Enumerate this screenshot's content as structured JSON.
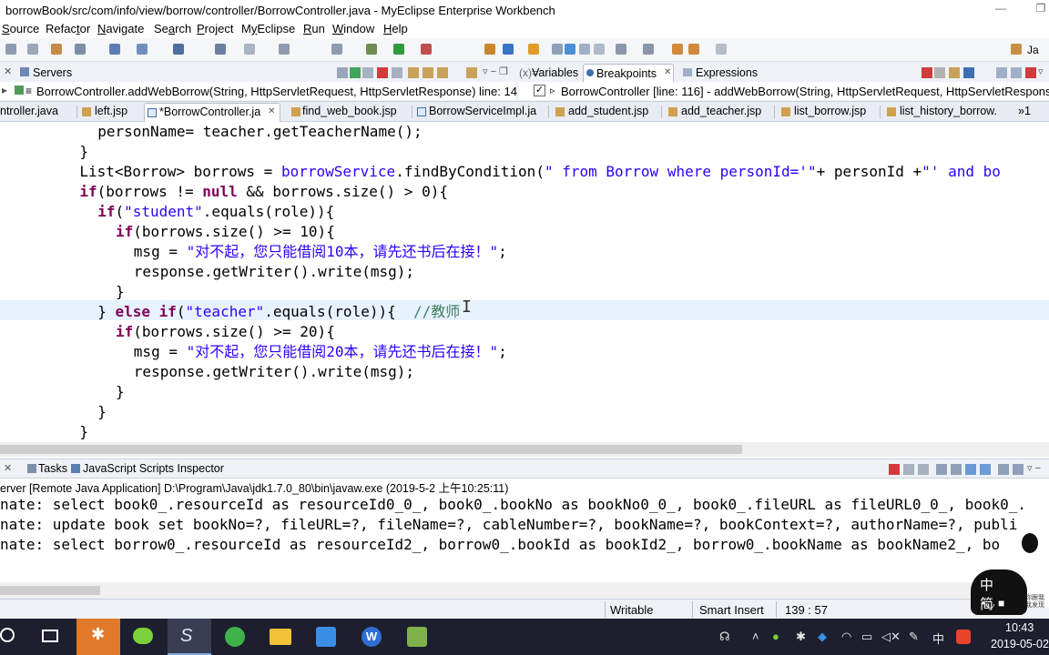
{
  "window": {
    "title": "borrowBook/src/com/info/view/borrow/controller/BorrowController.java - MyEclipse Enterprise Workbench",
    "minimize": "—",
    "restore": "❐"
  },
  "menu": [
    {
      "label": "Source",
      "mnemonic": "S"
    },
    {
      "label": "Refactor",
      "mnemonic": "t"
    },
    {
      "label": "Navigate",
      "mnemonic": "N"
    },
    {
      "label": "Search",
      "mnemonic": "a"
    },
    {
      "label": "Project",
      "mnemonic": "P"
    },
    {
      "label": "MyEclipse",
      "mnemonic": "y"
    },
    {
      "label": "Run",
      "mnemonic": "R"
    },
    {
      "label": "Window",
      "mnemonic": "W"
    },
    {
      "label": "Help",
      "mnemonic": "H"
    }
  ],
  "perspective": {
    "label": "Ja"
  },
  "top_views": {
    "servers_tab": "Servers",
    "debug_tabs": [
      "Variables",
      "Breakpoints",
      "Expressions"
    ],
    "stack_frame": "BorrowController.addWebBorrow(String, HttpServletRequest, HttpServletResponse) line: 14",
    "breakpoint_item": "BorrowController [line: 116] - addWebBorrow(String, HttpServletRequest, HttpServletRespons"
  },
  "editor_tabs": [
    {
      "label": "ntroller.java"
    },
    {
      "label": "left.jsp"
    },
    {
      "label": "*BorrowController.ja"
    },
    {
      "label": "find_web_book.jsp"
    },
    {
      "label": "BorrowServiceImpl.ja"
    },
    {
      "label": "add_student.jsp"
    },
    {
      "label": "add_teacher.jsp"
    },
    {
      "label": "list_borrow.jsp"
    },
    {
      "label": "list_history_borrow."
    },
    {
      "label": "»1"
    }
  ],
  "code_lines": [
    {
      "indent": "        ",
      "parts": [
        {
          "t": "personName= teacher.getTeacherName();",
          "c": ""
        }
      ]
    },
    {
      "indent": "      ",
      "parts": [
        {
          "t": "}",
          "c": ""
        }
      ]
    },
    {
      "indent": "      ",
      "parts": [
        {
          "t": "List<Borrow> borrows = ",
          "c": ""
        },
        {
          "t": "borrowService",
          "c": "str"
        },
        {
          "t": ".findByCondition(",
          "c": ""
        },
        {
          "t": "\" from Borrow where personId='\"",
          "c": "str"
        },
        {
          "t": "+ personId +",
          "c": ""
        },
        {
          "t": "\"' and bo",
          "c": "str"
        }
      ]
    },
    {
      "indent": "      ",
      "parts": [
        {
          "t": "if",
          "c": "kw"
        },
        {
          "t": "(borrows != ",
          "c": ""
        },
        {
          "t": "null",
          "c": "kw"
        },
        {
          "t": " && borrows.size() > 0){",
          "c": ""
        }
      ]
    },
    {
      "indent": "        ",
      "parts": [
        {
          "t": "if",
          "c": "kw"
        },
        {
          "t": "(",
          "c": ""
        },
        {
          "t": "\"student\"",
          "c": "str"
        },
        {
          "t": ".equals(role)){",
          "c": ""
        }
      ]
    },
    {
      "indent": "          ",
      "parts": [
        {
          "t": "if",
          "c": "kw"
        },
        {
          "t": "(borrows.size() >= 10){",
          "c": ""
        }
      ]
    },
    {
      "indent": "            ",
      "parts": [
        {
          "t": "msg = ",
          "c": ""
        },
        {
          "t": "\"对不起，您只能借阅10本，请先还书后在接！\"",
          "c": "str"
        },
        {
          "t": ";",
          "c": ""
        }
      ]
    },
    {
      "indent": "            ",
      "parts": [
        {
          "t": "response.getWriter().write(msg);",
          "c": ""
        }
      ]
    },
    {
      "indent": "          ",
      "parts": [
        {
          "t": "}",
          "c": ""
        }
      ]
    },
    {
      "indent": "        ",
      "parts": [
        {
          "t": "} ",
          "c": ""
        },
        {
          "t": "else if",
          "c": "kw"
        },
        {
          "t": "(",
          "c": ""
        },
        {
          "t": "\"teacher\"",
          "c": "str"
        },
        {
          "t": ".equals(role)){  ",
          "c": ""
        },
        {
          "t": "//教师",
          "c": "cmt"
        }
      ]
    },
    {
      "indent": "          ",
      "parts": [
        {
          "t": "if",
          "c": "kw"
        },
        {
          "t": "(borrows.size() >= 20){",
          "c": ""
        }
      ]
    },
    {
      "indent": "            ",
      "parts": [
        {
          "t": "msg = ",
          "c": ""
        },
        {
          "t": "\"对不起，您只能借阅20本，请先还书后在接！\"",
          "c": "str"
        },
        {
          "t": ";",
          "c": ""
        }
      ]
    },
    {
      "indent": "            ",
      "parts": [
        {
          "t": "response.getWriter().write(msg);",
          "c": ""
        }
      ]
    },
    {
      "indent": "          ",
      "parts": [
        {
          "t": "}",
          "c": ""
        }
      ]
    },
    {
      "indent": "        ",
      "parts": [
        {
          "t": "}",
          "c": ""
        }
      ]
    },
    {
      "indent": "      ",
      "parts": [
        {
          "t": "}",
          "c": ""
        }
      ]
    }
  ],
  "console": {
    "tabs": [
      "Tasks",
      "JavaScript Scripts Inspector"
    ],
    "header": "erver [Remote Java Application] D:\\Program\\Java\\jdk1.7.0_80\\bin\\javaw.exe (2019-5-2 上午10:25:11)",
    "lines": [
      "nate: select book0_.resourceId as resourceId0_0_, book0_.bookNo as bookNo0_0_, book0_.fileURL as fileURL0_0_, book0_.",
      "nate: update book set bookNo=?, fileURL=?, fileName=?, cableNumber=?, bookName=?, bookContext=?, authorName=?, publi",
      "nate: select borrow0_.resourceId as resourceId2_, borrow0_.bookId as bookId2_, borrow0_.bookName as bookName2_, bo"
    ]
  },
  "status": {
    "writable": "Writable",
    "insert_mode": "Smart Insert",
    "position": "139 : 57"
  },
  "ime": {
    "label": "中 简",
    "sub": "你跟我\n我发现"
  },
  "taskbar": {
    "time": "10:43",
    "date": "2019-05-02",
    "lang": "中"
  },
  "colors": {
    "keyword": "#7f0055",
    "string": "#2a00ff",
    "comment": "#3f7f5f",
    "taskbar": "#1d1f2f"
  }
}
